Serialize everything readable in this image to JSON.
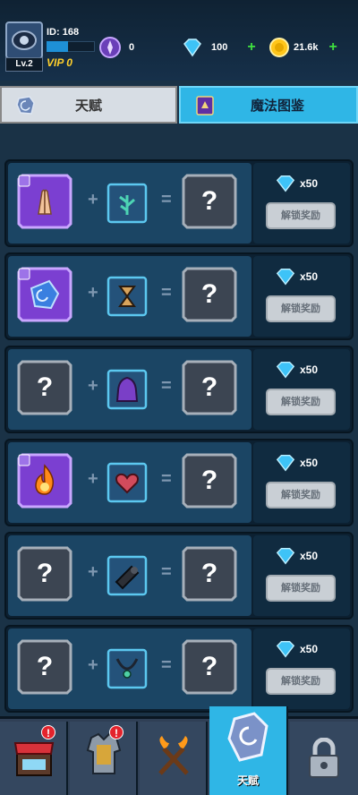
{
  "player": {
    "id_label": "ID: 168",
    "level": "Lv.2",
    "vip": "VIP 0",
    "xp_fraction": 0.45
  },
  "resources": {
    "orb": "0",
    "gems": "100",
    "gold": "21.6k"
  },
  "tabs": [
    {
      "label": "天赋",
      "active": false
    },
    {
      "label": "魔法图鉴",
      "active": true
    }
  ],
  "recipes": [
    {
      "base_item": "praying-hands-icon",
      "base_unlocked": true,
      "ingredient": "herb-icon",
      "result": "?",
      "reward": "x50",
      "button": "解锁奖励"
    },
    {
      "base_item": "blue-gem-icon",
      "base_unlocked": true,
      "ingredient": "hourglass-icon",
      "result": "?",
      "reward": "x50",
      "button": "解锁奖励"
    },
    {
      "base_item": "?",
      "base_unlocked": false,
      "ingredient": "purple-cloak-icon",
      "result": "?",
      "reward": "x50",
      "button": "解锁奖励"
    },
    {
      "base_item": "fireball-icon",
      "base_unlocked": true,
      "ingredient": "heart-icon",
      "result": "?",
      "reward": "x50",
      "button": "解锁奖励"
    },
    {
      "base_item": "?",
      "base_unlocked": false,
      "ingredient": "cannon-icon",
      "result": "?",
      "reward": "x50",
      "button": "解锁奖励"
    },
    {
      "base_item": "?",
      "base_unlocked": false,
      "ingredient": "necklace-icon",
      "result": "?",
      "reward": "x50",
      "button": "解锁奖励"
    }
  ],
  "nav": [
    {
      "name": "shop-icon",
      "label": "",
      "badge": "!"
    },
    {
      "name": "armor-icon",
      "label": "",
      "badge": "!"
    },
    {
      "name": "crossed-torches-icon",
      "label": ""
    },
    {
      "name": "rune-stone-icon",
      "label": "天赋",
      "active": true
    },
    {
      "name": "lock-icon",
      "label": ""
    }
  ],
  "colors": {
    "accent": "#2fb6e6",
    "gem": "#3ec3f7",
    "gold": "#ffd02c",
    "plus": "#3fe03f"
  }
}
